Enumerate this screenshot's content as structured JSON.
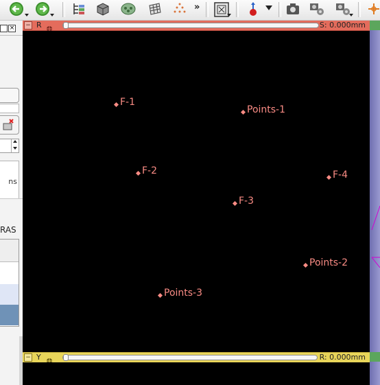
{
  "toolbar": {
    "more_label": "»",
    "icons": [
      "back-arrow-icon",
      "forward-arrow-icon",
      "data-tree-icon",
      "cube-icon",
      "models-icon",
      "grid-icon",
      "points-icon",
      "layout-icon",
      "fiducial-place-icon",
      "screenshot-icon",
      "scene-snapshot-icon",
      "scene-restore-icon",
      "crosshair-icon"
    ]
  },
  "red_slice": {
    "label": "R",
    "offset": "S: 0.000mm",
    "color": "#e46c5c"
  },
  "yellow_slice": {
    "label": "Y",
    "offset": "R: 0.000mm",
    "color": "#e8d55a"
  },
  "left_panel": {
    "fragment_ns": "ns",
    "fragment_ras": "RAS"
  },
  "fiducials": [
    {
      "label": "F-1"
    },
    {
      "label": "Points-1"
    },
    {
      "label": "F-2"
    },
    {
      "label": "F-4"
    },
    {
      "label": "F-3"
    },
    {
      "label": "Points-2"
    },
    {
      "label": "Points-3"
    }
  ],
  "colors": {
    "fiducial": "#f98b84",
    "viewer_bg": "#000000",
    "green_slice": "#5ca65c",
    "magenta_line": "#d100d1"
  }
}
